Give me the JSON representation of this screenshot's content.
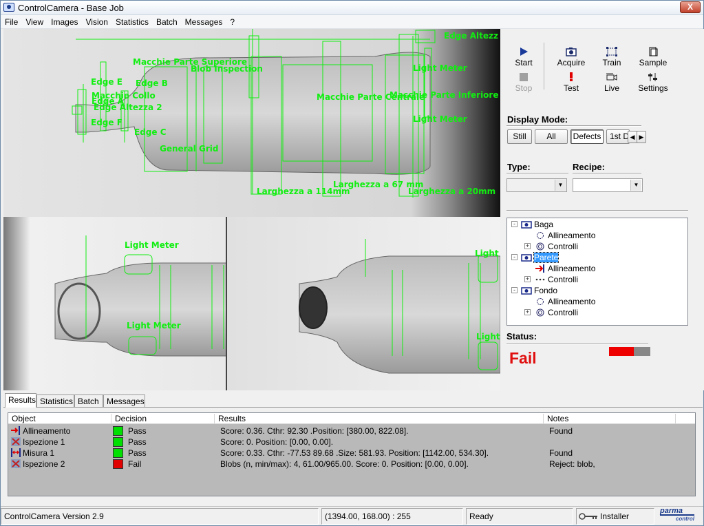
{
  "window": {
    "title": "ControlCamera - Base Job",
    "close_label": "X"
  },
  "menu": [
    "File",
    "View",
    "Images",
    "Vision",
    "Statistics",
    "Batch",
    "Messages",
    "?"
  ],
  "overlay_labels": {
    "edge_altezza": "Edge Altezz",
    "macchie_sup": "Macchie Parte Superiore",
    "blob": "Blob Inspection",
    "edge_e": "Edge E",
    "edge_b": "Edge B",
    "macchie_collo": "Macchie Collo",
    "edge_a": "Edge A",
    "edge_altezza2": "Edge Altezza 2",
    "edge_f": "Edge F",
    "edge_c": "Edge C",
    "general_grid": "General Grid",
    "macchie_centrale": "Macchie Parte Centrale",
    "macchie_inf": "Macchie Parte Inferiore",
    "light_meter_1": "Light Meter",
    "light_meter_2": "Light Meter",
    "larghezza_114": "Larghezza a 114mm",
    "larghezza_67": "Larghezza a 67 mm",
    "larghezza_20": "Larghezza a 20mm",
    "lm_a": "Light Meter",
    "lm_b": "Light Meter",
    "lm_c": "Light",
    "lm_d": "Light"
  },
  "toolbar": {
    "start": "Start",
    "stop": "Stop",
    "acquire": "Acquire",
    "train": "Train",
    "sample": "Sample",
    "test": "Test",
    "live": "Live",
    "settings": "Settings"
  },
  "display_mode": {
    "label": "Display Mode:",
    "buttons": [
      "Still",
      "All",
      "Defects",
      "1st D"
    ],
    "selected": "Defects"
  },
  "type_label": "Type:",
  "recipe_label": "Recipe:",
  "tree": [
    {
      "label": "Baga",
      "level": 0,
      "expander": "-",
      "icon": "camera-icon"
    },
    {
      "label": "Allineamento",
      "level": 1,
      "expander": "",
      "icon": "align-icon"
    },
    {
      "label": "Controlli",
      "level": 1,
      "expander": "+",
      "icon": "target-icon"
    },
    {
      "label": "Parete",
      "level": 0,
      "expander": "-",
      "icon": "camera-icon",
      "selected": true
    },
    {
      "label": "Allineamento",
      "level": 1,
      "expander": "",
      "icon": "arrow-icon"
    },
    {
      "label": "Controlli",
      "level": 1,
      "expander": "+",
      "icon": "dots-icon"
    },
    {
      "label": "Fondo",
      "level": 0,
      "expander": "-",
      "icon": "camera-icon"
    },
    {
      "label": "Allineamento",
      "level": 1,
      "expander": "",
      "icon": "align-icon"
    },
    {
      "label": "Controlli",
      "level": 1,
      "expander": "+",
      "icon": "target-icon"
    }
  ],
  "status": {
    "label": "Status:",
    "value": "Fail",
    "fail_fraction": 0.6,
    "fail_color": "#ee0000"
  },
  "tabs": [
    "Results",
    "Statistics",
    "Batch",
    "Messages"
  ],
  "active_tab": "Results",
  "results": {
    "columns": [
      "Object",
      "Decision",
      "Results",
      "Notes"
    ],
    "rows": [
      {
        "object": "Allineamento",
        "icon": "arrow-icon",
        "decision": "Pass",
        "color": "#00e000",
        "result": "Score: 0.36. Cthr: 92.30 .Position: [380.00, 822.08].",
        "notes": "Found"
      },
      {
        "object": "Ispezione 1",
        "icon": "cross-icon",
        "decision": "Pass",
        "color": "#00e000",
        "result": "Score: 0. Position: [0.00, 0.00].",
        "notes": ""
      },
      {
        "object": "Misura 1",
        "icon": "measure-icon",
        "decision": "Pass",
        "color": "#00e000",
        "result": "Score: 0.33. Cthr: -77.53 89.68 .Size: 581.93. Position: [1142.00, 534.30].",
        "notes": "Found"
      },
      {
        "object": "Ispezione 2",
        "icon": "cross-icon",
        "decision": "Fail",
        "color": "#e00000",
        "result": "Blobs (n, min/max): 4, 61.00/965.00. Score: 0. Position: [0.00, 0.00].",
        "notes": "Reject: blob,"
      }
    ]
  },
  "statusbar": {
    "version": "ControlCamera Version 2.9",
    "coords": "(1394.00, 168.00) : 255",
    "state": "Ready",
    "user": "Installer",
    "logo": "parma control"
  }
}
